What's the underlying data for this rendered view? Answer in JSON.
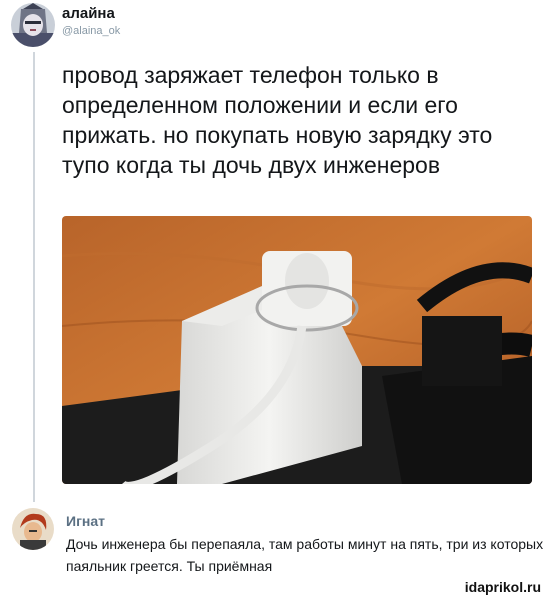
{
  "tweet": {
    "author_name": "алайна",
    "author_handle": "@alaina_ok",
    "text": "провод заряжает телефон только в определенном положении и если его прижать. но покупать новую зарядку это тупо когда ты дочь двух инженеров"
  },
  "reply": {
    "author_name": "Игнат",
    "text": "Дочь инженера бы перепаяла, там работы минут на пять, три из которых паяльник греется. Ты приёмная"
  },
  "watermark": "idaprikol.ru"
}
